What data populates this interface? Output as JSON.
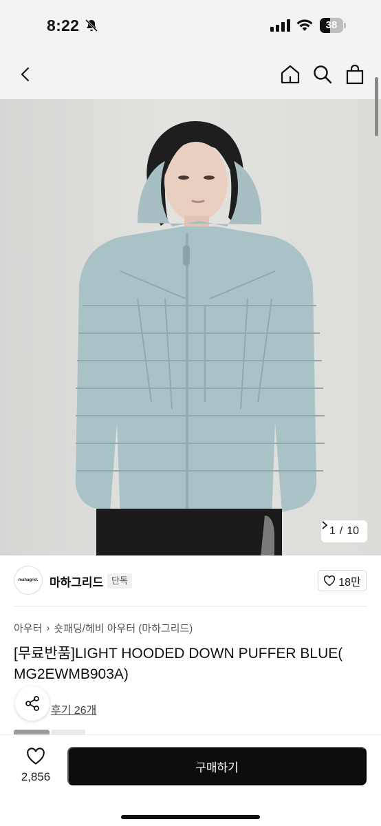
{
  "status_bar": {
    "time": "8:22",
    "battery": "38"
  },
  "gallery": {
    "current": "1",
    "separator": "/",
    "total": "10"
  },
  "brand": {
    "logo_text": "mahagrid.",
    "name": "마하그리드",
    "badge": "단독",
    "likes": "18만"
  },
  "breadcrumb": {
    "level1": "아우터",
    "separator": "›",
    "level2": "숏패딩/헤비 아우터 (마하그리드)"
  },
  "product": {
    "title": "[무료반품]LIGHT HOODED DOWN PUFFER BLUE( MG2EWMB903A)"
  },
  "reviews": {
    "label": "후기 26개"
  },
  "bottom_bar": {
    "wish_count": "2,856",
    "buy_label": "구매하기"
  },
  "icons": {
    "nav": [
      "back-icon",
      "home-icon",
      "search-icon",
      "bag-icon"
    ],
    "status": [
      "mute-bell-icon",
      "signal-icon",
      "wifi-icon",
      "battery-icon"
    ],
    "actions": [
      "heart-icon",
      "share-icon"
    ]
  },
  "colors": {
    "buy_button": "#0d0d0d",
    "header_bg": "#f3f3f3",
    "jacket": "#a9c2c6"
  }
}
